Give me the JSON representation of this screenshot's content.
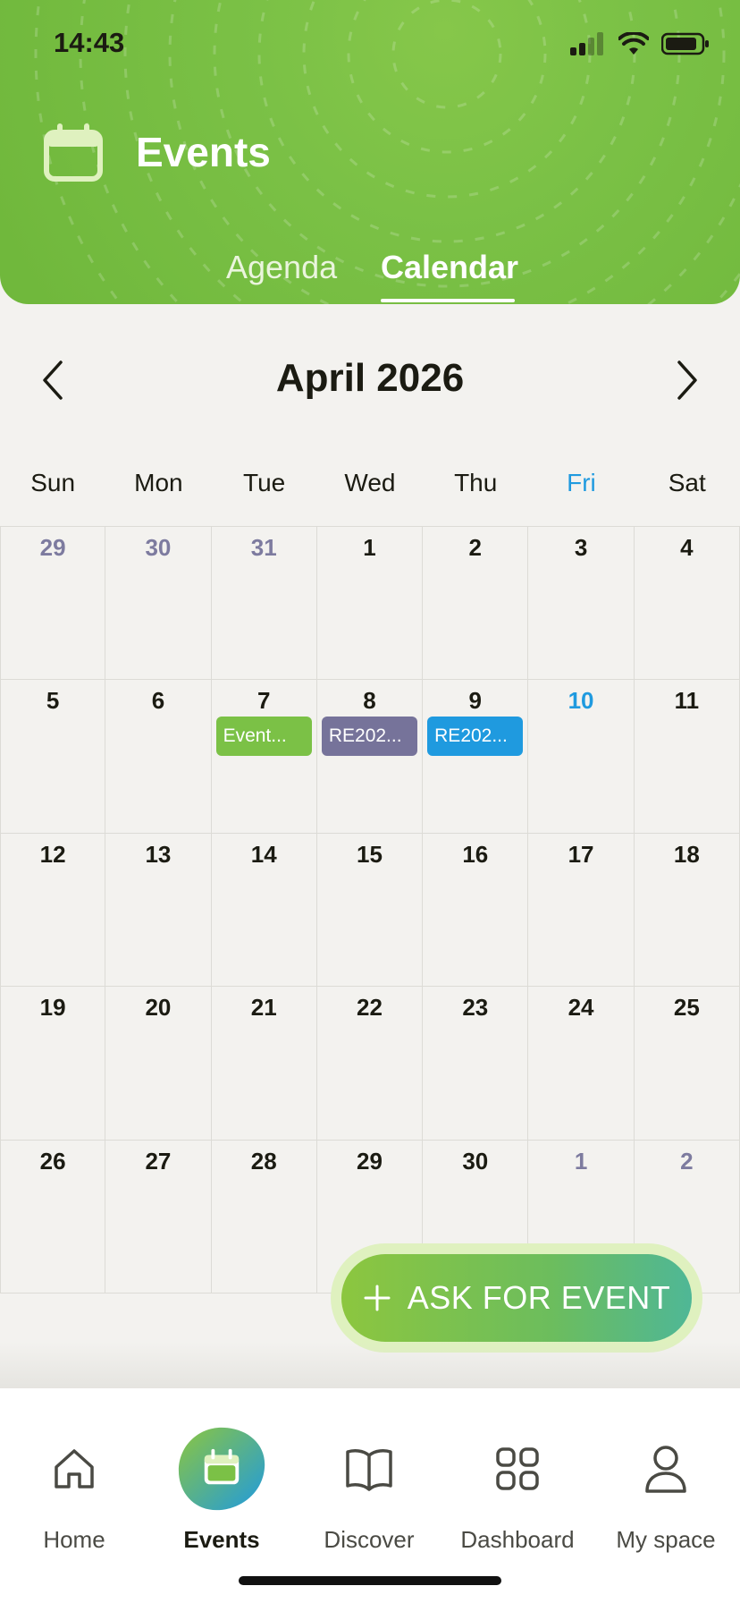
{
  "status_bar": {
    "time": "14:43"
  },
  "header": {
    "title": "Events",
    "icon": "calendar-icon"
  },
  "tabs": [
    {
      "label": "Agenda",
      "active": false
    },
    {
      "label": "Calendar",
      "active": true
    }
  ],
  "calendar": {
    "month_label": "April 2026",
    "weekdays": [
      "Sun",
      "Mon",
      "Tue",
      "Wed",
      "Thu",
      "Fri",
      "Sat"
    ],
    "today_weekday": "Fri",
    "weeks": [
      [
        {
          "d": "29",
          "other": true
        },
        {
          "d": "30",
          "other": true
        },
        {
          "d": "31",
          "other": true
        },
        {
          "d": "1"
        },
        {
          "d": "2"
        },
        {
          "d": "3"
        },
        {
          "d": "4"
        }
      ],
      [
        {
          "d": "5"
        },
        {
          "d": "6"
        },
        {
          "d": "7",
          "event": {
            "label": "Event...",
            "color": "#7bc146"
          }
        },
        {
          "d": "8",
          "event": {
            "label": "RE202...",
            "color": "#76739a"
          }
        },
        {
          "d": "9",
          "event": {
            "label": "RE202...",
            "color": "#1f9adf"
          }
        },
        {
          "d": "10",
          "today": true
        },
        {
          "d": "11"
        }
      ],
      [
        {
          "d": "12"
        },
        {
          "d": "13"
        },
        {
          "d": "14"
        },
        {
          "d": "15"
        },
        {
          "d": "16"
        },
        {
          "d": "17"
        },
        {
          "d": "18"
        }
      ],
      [
        {
          "d": "19"
        },
        {
          "d": "20"
        },
        {
          "d": "21"
        },
        {
          "d": "22"
        },
        {
          "d": "23"
        },
        {
          "d": "24"
        },
        {
          "d": "25"
        }
      ],
      [
        {
          "d": "26"
        },
        {
          "d": "27"
        },
        {
          "d": "28"
        },
        {
          "d": "29"
        },
        {
          "d": "30"
        },
        {
          "d": "1",
          "other": true
        },
        {
          "d": "2",
          "other": true
        }
      ]
    ]
  },
  "fab": {
    "label": "ASK FOR EVENT",
    "icon": "plus-icon"
  },
  "bottom_nav": [
    {
      "label": "Home",
      "icon": "home-icon",
      "active": false
    },
    {
      "label": "Events",
      "icon": "calendar-icon",
      "active": true
    },
    {
      "label": "Discover",
      "icon": "book-icon",
      "active": false
    },
    {
      "label": "Dashboard",
      "icon": "grid-icon",
      "active": false
    },
    {
      "label": "My space",
      "icon": "user-icon",
      "active": false
    }
  ],
  "colors": {
    "brand_green": "#7bc146",
    "accent_blue": "#1f9adf",
    "muted_purple": "#76739a",
    "background": "#f3f2ef"
  }
}
